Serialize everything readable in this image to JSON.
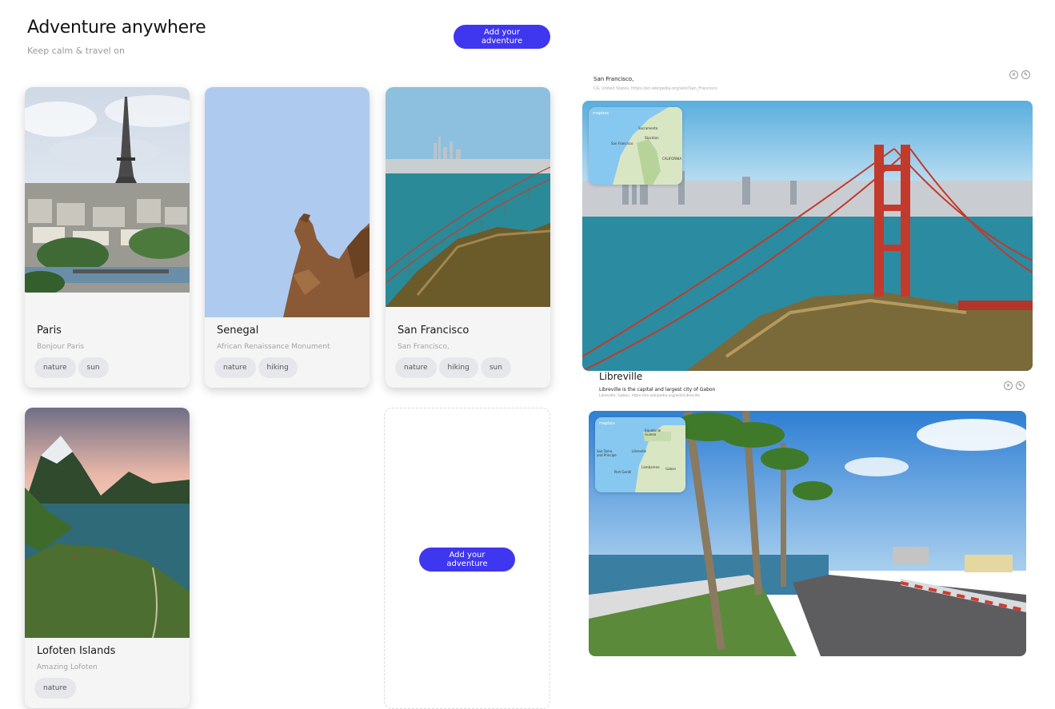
{
  "header": {
    "title": "Adventure anywhere",
    "subtitle": "Keep calm & travel on",
    "add_button": "Add your adventure"
  },
  "cards": [
    {
      "name": "Paris",
      "description": "Bonjour Paris",
      "tags": [
        "nature",
        "sun"
      ]
    },
    {
      "name": "Senegal",
      "description": "African Renaissance Monument",
      "tags": [
        "nature",
        "hiking"
      ]
    },
    {
      "name": "San Francisco",
      "description": "San Francisco,",
      "tags": [
        "nature",
        "hiking",
        "sun"
      ]
    },
    {
      "name": "Lofoten Islands",
      "description": "Amazing Lofoten",
      "tags": [
        "nature"
      ]
    }
  ],
  "empty_card": {
    "add_button": "Add your adventure"
  },
  "details": [
    {
      "title": "San Francisco,",
      "subtitle": "CA, United States, https://en.wikipedia.org/wiki/San_Francisco",
      "map_brand": "mapbox",
      "map_labels": [
        "Sacramento",
        "Stockton",
        "San Francisco",
        "CALIFORNIA"
      ]
    },
    {
      "title": "Libreville",
      "description": "Libreville is the capital and largest city of Gabon",
      "subtitle": "Libreville, Gabon, https://en.wikipedia.org/wiki/Libreville",
      "map_brand": "mapbox",
      "map_labels": [
        "Equatorial Guinea",
        "Sao Tome and Principe",
        "Libreville",
        "Lambarene",
        "Gabon",
        "Port-Gentil"
      ]
    }
  ],
  "colors": {
    "accent": "#3f36f0",
    "card_bg": "#f5f5f6",
    "tag_bg": "#e6e7ea"
  }
}
